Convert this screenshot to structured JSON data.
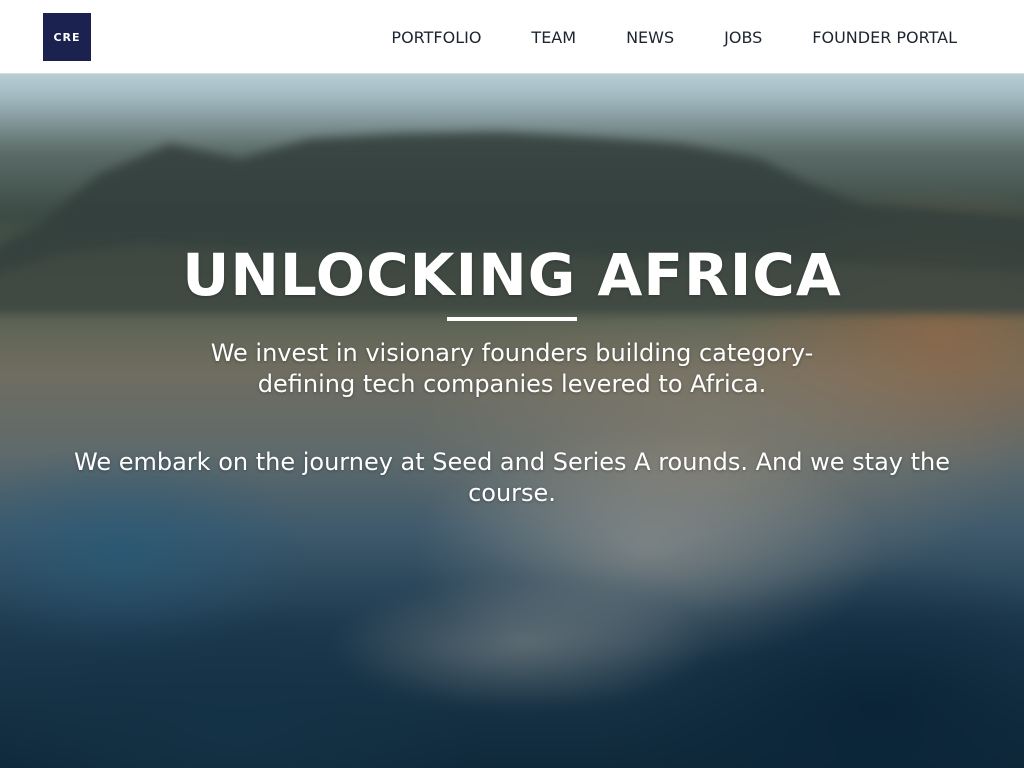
{
  "header": {
    "logo_text": "CRE",
    "nav": [
      {
        "label": "PORTFOLIO"
      },
      {
        "label": "TEAM"
      },
      {
        "label": "NEWS"
      },
      {
        "label": "JOBS"
      },
      {
        "label": "FOUNDER PORTAL"
      }
    ]
  },
  "hero": {
    "title": "UNLOCKING AFRICA",
    "lead": "We invest in visionary founders building category-defining tech companies levered to Africa.",
    "sub": "We embark on the journey at Seed and Series A rounds. And we stay the course.",
    "background": "blurred aerial photo of a coastal city below a mountain"
  },
  "colors": {
    "logo_bg": "#1c2250",
    "nav_text": "#1d2530",
    "header_bg": "#ffffff",
    "hero_text": "#ffffff"
  }
}
